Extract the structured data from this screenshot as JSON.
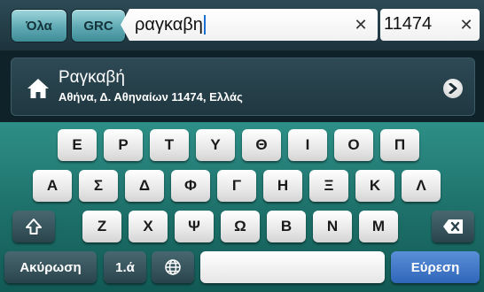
{
  "topbar": {
    "tab_all": "Όλα",
    "tab_country": "GRC",
    "search_value": "ραγκαβη",
    "zip_value": "11474",
    "clear_glyph": "✕"
  },
  "result": {
    "title": "Ραγκαβή",
    "subtitle": "Αθήνα, Δ. Αθηναίων 11474, Ελλάς",
    "icon": "home-icon",
    "action_icon": "chevron-right-icon"
  },
  "keyboard": {
    "row1": [
      "Ε",
      "Ρ",
      "Τ",
      "Υ",
      "Θ",
      "Ι",
      "Ο",
      "Π"
    ],
    "row2": [
      "Α",
      "Σ",
      "Δ",
      "Φ",
      "Γ",
      "Η",
      "Ξ",
      "Κ",
      "Λ"
    ],
    "row3": [
      "Ζ",
      "Χ",
      "Ψ",
      "Ω",
      "Β",
      "Ν",
      "Μ"
    ],
    "shift_icon": "shift-icon",
    "backspace_icon": "backspace-icon",
    "cancel_label": "Ακύρωση",
    "symbols_label": "1.ά",
    "globe_icon": "globe-icon",
    "search_label": "Εύρεση"
  },
  "colors": {
    "keyboard_bg": "#1d6f69",
    "search_key": "#2f66b8",
    "tab_button": "#5fa9b3"
  }
}
